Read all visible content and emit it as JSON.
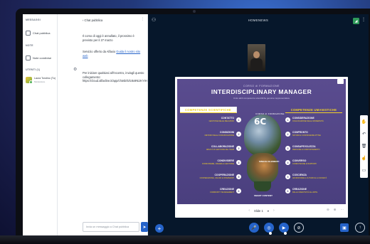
{
  "left_panel": {
    "messages_label": "MESSAGGI",
    "public_chat_label": "Chat pubblica",
    "notes_label": "NOTE",
    "shared_notes_label": "Note condivise",
    "users_label": "UTENTI (1)",
    "user_name": "Laura Tondino (Tu)",
    "user_role": "Moderatore"
  },
  "chat": {
    "back_label": "‹ Chat pubblica",
    "messages": [
      [
        "Il corso di oggi è annullato, il prossimo è previsto per il 27 marzo"
      ],
      [
        "Servizio offerto da Alfaxio ",
        {
          "link": "Guida il nostro sito web"
        }
      ],
      [
        "Per iniziare qualsiasi all'incontro, inviagli questo collegamento: https://cloud.alfaxline.it/app/chiebi/5/ic8x9NiJKYIH"
      ]
    ],
    "input_placeholder": "Invia un messaggio a Chat pubblica"
  },
  "main": {
    "meeting_title": "HOMENEWS"
  },
  "slide": {
    "pre_title": "CORSO di FORMAZIONE",
    "title": "INTERDISCIPLINARY MANAGER",
    "subtitle": "Unire abili competenze scientifiche genuine rappresentative",
    "left_header": "COMPETENZE SCIENTIFICHE",
    "right_header": "COMPETENZE UMANISTICHE",
    "left_items": [
      {
        "num": "1",
        "name": "CONTATTO",
        "desc": "GESTIONE DELLE RELAZIONI"
      },
      {
        "num": "2",
        "name": "CONDIZIONI",
        "desc": "METODO NELLA COMUNICAZIONE"
      },
      {
        "num": "3",
        "name": "COLLABORAZIONE",
        "desc": "ABILITÀ DI GESTIONE DEL TEAM"
      },
      {
        "num": "4",
        "name": "CONDIVIDERE",
        "desc": "CONDIVIDERE, CREARE E GESTIONE"
      },
      {
        "num": "5",
        "name": "COOPERAZIONE",
        "desc": "COOPERAZIONE, VALORI E INTERVENTI"
      },
      {
        "num": "6",
        "name": "CREAZIONE",
        "desc": "COMMUNITY MANAGEMENT"
      }
    ],
    "right_items": [
      {
        "num": "1",
        "name": "CONSIDERAZIONE",
        "desc": "COLLOCAZIONE NELLA MODERNITÀ"
      },
      {
        "num": "2",
        "name": "CONFRONTO",
        "desc": "NATURA E CONOSCENZE ATTIVE"
      },
      {
        "num": "3",
        "name": "CONSAPEVOLEZZA",
        "desc": "PERSONE E COMPORTAMENTO"
      },
      {
        "num": "4",
        "name": "CONVERSO",
        "desc": "CONDIVISIONE E RAPPORTI"
      },
      {
        "num": "5",
        "name": "COSCIENZA",
        "desc": "AFFRONTARE IL FUTURO E LA SOCIETÀ"
      },
      {
        "num": "6",
        "name": "CREAZIONE",
        "desc": "DALLA CREATIVITÀ ALL'ARTE"
      }
    ],
    "big_text": "6C",
    "center_small": "CORSO di FORMAZIONE",
    "center_label_1": "SINGOLI ELEMENTI",
    "center_label_2": "SMART CONTENT",
    "page_label": "Slide 1"
  },
  "colors": {
    "accent": "#2563c9",
    "slide_bg": "#4a3f7e",
    "highlight": "#f2d227",
    "main_bg": "#06172b"
  }
}
